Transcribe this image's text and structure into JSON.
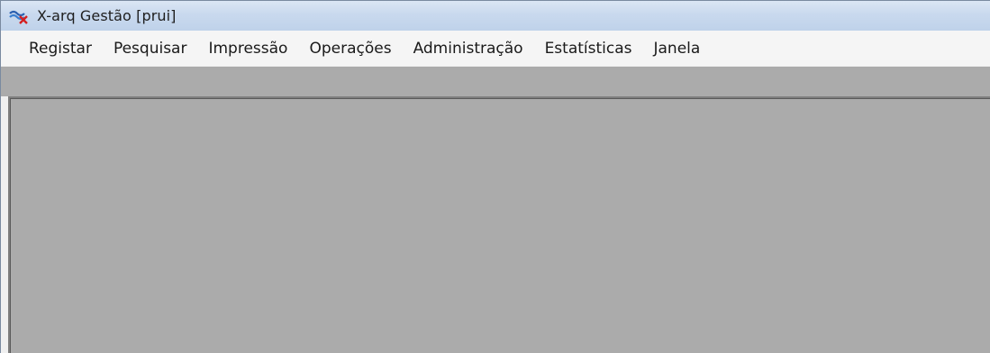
{
  "window": {
    "title": "X-arq Gestão [prui]",
    "icon": "x-arq-app-icon"
  },
  "menubar": {
    "items": [
      {
        "label": "Registar"
      },
      {
        "label": "Pesquisar"
      },
      {
        "label": "Impressão"
      },
      {
        "label": "Operações"
      },
      {
        "label": "Administração"
      },
      {
        "label": "Estatísticas"
      },
      {
        "label": "Janela"
      }
    ]
  },
  "colors": {
    "workspace": "#ababab",
    "titlebar": "#c9d9ee",
    "menubar": "#f5f5f5"
  }
}
